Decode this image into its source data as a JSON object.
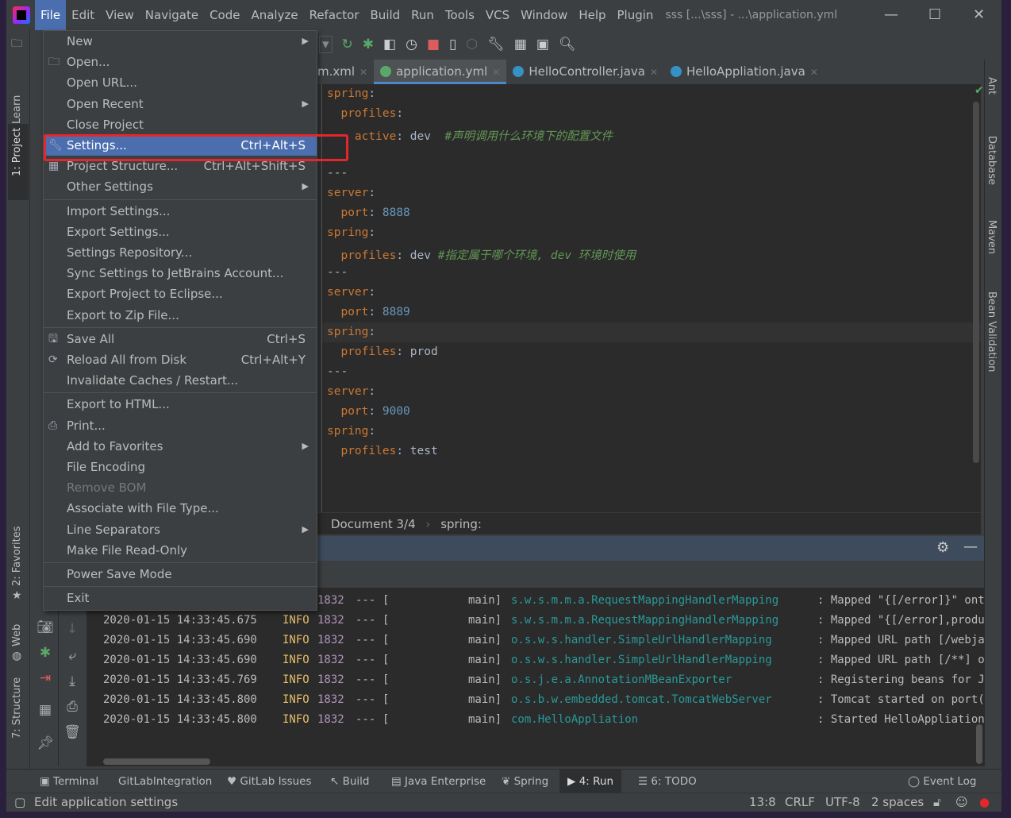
{
  "window": {
    "title": "sss [...\\sss] - ...\\application.yml"
  },
  "menubar": [
    "File",
    "Edit",
    "View",
    "Navigate",
    "Code",
    "Analyze",
    "Refactor",
    "Build",
    "Run",
    "Tools",
    "VCS",
    "Window",
    "Help",
    "Plugin"
  ],
  "tabs": [
    {
      "label": "m.xml"
    },
    {
      "label": "application.yml",
      "selected": true
    },
    {
      "label": "HelloController.java"
    },
    {
      "label": "HelloAppliation.java"
    }
  ],
  "editor": {
    "lines": [
      [
        [
          "k",
          "spring"
        ],
        [
          "v",
          ":"
        ]
      ],
      [
        [
          "v",
          "  "
        ],
        [
          "k",
          "profiles"
        ],
        [
          "v",
          ":"
        ]
      ],
      [
        [
          "v",
          "    "
        ],
        [
          "k",
          "active"
        ],
        [
          "v",
          ": dev  "
        ],
        [
          "c",
          "#声明调用什么环境下的配置文件"
        ]
      ],
      [
        [
          "v",
          ""
        ]
      ],
      [
        [
          "v",
          "---"
        ]
      ],
      [
        [
          "k",
          "server"
        ],
        [
          "v",
          ":"
        ]
      ],
      [
        [
          "v",
          "  "
        ],
        [
          "k",
          "port"
        ],
        [
          "v",
          ": "
        ],
        [
          "n",
          "8888"
        ]
      ],
      [
        [
          "k",
          "spring"
        ],
        [
          "v",
          ":"
        ]
      ],
      [
        [
          "v",
          "  "
        ],
        [
          "k",
          "profiles"
        ],
        [
          "v",
          ": dev "
        ],
        [
          "c",
          "#指定属于哪个环境, dev 环境时使用"
        ]
      ],
      [
        [
          "v",
          "---"
        ]
      ],
      [
        [
          "k",
          "server"
        ],
        [
          "v",
          ":"
        ]
      ],
      [
        [
          "v",
          "  "
        ],
        [
          "k",
          "port"
        ],
        [
          "v",
          ": "
        ],
        [
          "n",
          "8889"
        ]
      ],
      [
        [
          "k",
          "spring"
        ],
        [
          "v",
          ":"
        ]
      ],
      [
        [
          "v",
          "  "
        ],
        [
          "k",
          "profiles"
        ],
        [
          "v",
          ": prod"
        ]
      ],
      [
        [
          "v",
          "---"
        ]
      ],
      [
        [
          "k",
          "server"
        ],
        [
          "v",
          ":"
        ]
      ],
      [
        [
          "v",
          "  "
        ],
        [
          "k",
          "port"
        ],
        [
          "v",
          ": "
        ],
        [
          "n",
          "9000"
        ]
      ],
      [
        [
          "k",
          "spring"
        ],
        [
          "v",
          ":"
        ]
      ],
      [
        [
          "v",
          "  "
        ],
        [
          "k",
          "profiles"
        ],
        [
          "v",
          ": test"
        ]
      ]
    ]
  },
  "breadcrumb": {
    "doc": "Document 3/4",
    "path": "spring:"
  },
  "console": [
    {
      "ts": "",
      "lvl": "",
      "pid": "1832",
      "sep": "---",
      "br": "[",
      "th": "main]",
      "logger": "s.w.s.m.m.a.RequestMappingHandlerMapping",
      "msg": ": Mapped \"{[/error]}\" onto"
    },
    {
      "ts": "2020-01-15 14:33:45.675",
      "lvl": "INFO",
      "pid": "1832",
      "sep": "---",
      "br": "[",
      "th": "main]",
      "logger": "s.w.s.m.m.a.RequestMappingHandlerMapping",
      "msg": ": Mapped \"{[/error],produc"
    },
    {
      "ts": "2020-01-15 14:33:45.690",
      "lvl": "INFO",
      "pid": "1832",
      "sep": "---",
      "br": "[",
      "th": "main]",
      "logger": "o.s.w.s.handler.SimpleUrlHandlerMapping",
      "msg": ": Mapped URL path [/webjar"
    },
    {
      "ts": "2020-01-15 14:33:45.690",
      "lvl": "INFO",
      "pid": "1832",
      "sep": "---",
      "br": "[",
      "th": "main]",
      "logger": "o.s.w.s.handler.SimpleUrlHandlerMapping",
      "msg": ": Mapped URL path [/**] on"
    },
    {
      "ts": "2020-01-15 14:33:45.769",
      "lvl": "INFO",
      "pid": "1832",
      "sep": "---",
      "br": "[",
      "th": "main]",
      "logger": "o.s.j.e.a.AnnotationMBeanExporter",
      "msg": ": Registering beans for JM"
    },
    {
      "ts": "2020-01-15 14:33:45.800",
      "lvl": "INFO",
      "pid": "1832",
      "sep": "---",
      "br": "[",
      "th": "main]",
      "logger": "o.s.b.w.embedded.tomcat.TomcatWebServer",
      "msg": ": Tomcat started on port(s"
    },
    {
      "ts": "2020-01-15 14:33:45.800",
      "lvl": "INFO",
      "pid": "1832",
      "sep": "---",
      "br": "[",
      "th": "main]",
      "logger": "com.HelloAppliation",
      "msg": ": Started HelloAppliation"
    }
  ],
  "file_menu": [
    {
      "label": "New",
      "arrow": true
    },
    {
      "label": "Open...",
      "icon": "folder"
    },
    {
      "label": "Open URL..."
    },
    {
      "label": "Open Recent",
      "arrow": true
    },
    {
      "label": "Close Project"
    },
    {
      "label": "Settings...",
      "shortcut": "Ctrl+Alt+S",
      "icon": "wrench",
      "selected": true
    },
    {
      "label": "Project Structure...",
      "shortcut": "Ctrl+Alt+Shift+S",
      "icon": "structure"
    },
    {
      "label": "Other Settings",
      "arrow": true
    },
    {
      "sep": true
    },
    {
      "label": "Import Settings..."
    },
    {
      "label": "Export Settings..."
    },
    {
      "label": "Settings Repository..."
    },
    {
      "label": "Sync Settings to JetBrains Account..."
    },
    {
      "label": "Export Project to Eclipse..."
    },
    {
      "label": "Export to Zip File..."
    },
    {
      "sep": true
    },
    {
      "label": "Save All",
      "shortcut": "Ctrl+S",
      "icon": "save"
    },
    {
      "label": "Reload All from Disk",
      "shortcut": "Ctrl+Alt+Y",
      "icon": "reload"
    },
    {
      "label": "Invalidate Caches / Restart..."
    },
    {
      "sep": true
    },
    {
      "label": "Export to HTML..."
    },
    {
      "label": "Print...",
      "icon": "print"
    },
    {
      "label": "Add to Favorites",
      "arrow": true
    },
    {
      "label": "File Encoding"
    },
    {
      "label": "Remove BOM",
      "disabled": true
    },
    {
      "label": "Associate with File Type..."
    },
    {
      "label": "Line Separators",
      "arrow": true
    },
    {
      "label": "Make File Read-Only"
    },
    {
      "sep": true
    },
    {
      "label": "Power Save Mode"
    },
    {
      "sep": true
    },
    {
      "label": "Exit"
    }
  ],
  "left_tools": {
    "learn": "Learn",
    "project": "1: Project",
    "favorites": "2: Favorites",
    "web": "Web",
    "structure": "7: Structure"
  },
  "right_tools": {
    "ant": "Ant",
    "database": "Database",
    "maven": "Maven",
    "bean": "Bean Validation"
  },
  "bottom_tools": {
    "terminal": "Terminal",
    "gitlab_int": "GitLabIntegration",
    "gitlab_issues": "GitLab Issues",
    "build": "Build",
    "java_ee": "Java Enterprise",
    "spring": "Spring",
    "run": "4: Run",
    "todo": "6: TODO",
    "event_log": "Event Log"
  },
  "status": {
    "message": "Edit application settings",
    "position": "13:8",
    "line_sep": "CRLF",
    "encoding": "UTF-8",
    "indent": "2 spaces"
  },
  "colors": {
    "accent": "#4b6eaf",
    "highlight_box": "#e5262b"
  }
}
